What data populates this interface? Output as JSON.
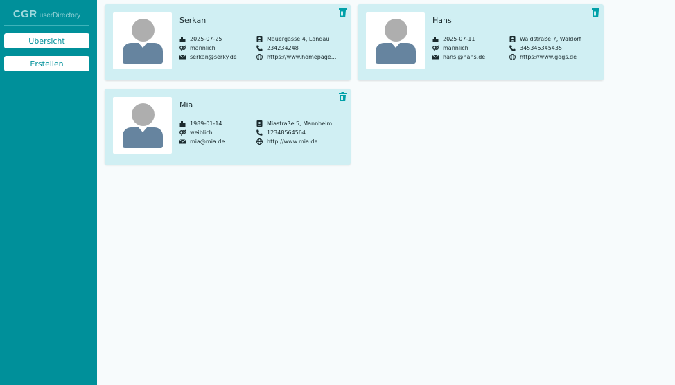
{
  "sidebar": {
    "logo_main": "CGR",
    "logo_sub": "userDirectory",
    "nav": [
      "Übersicht",
      "Erstellen"
    ]
  },
  "colors": {
    "sidebar": "#00909a",
    "card": "#d0eff3",
    "accent": "#00a0a8",
    "avatar_head": "#aeaeae",
    "avatar_body": "#66849f"
  },
  "users": [
    {
      "name": "Serkan",
      "birthday": "2025-07-25",
      "gender": "männlich",
      "email": "serkan@serky.de",
      "address": "Mauergasse 4, Landau",
      "phone": "234234248",
      "website": "https://www.homepage..."
    },
    {
      "name": "Hans",
      "birthday": "2025-07-11",
      "gender": "männlich",
      "email": "hansi@hans.de",
      "address": "Waldstraße 7, Waldorf",
      "phone": "345345345435",
      "website": "https://www.gdgs.de"
    },
    {
      "name": "Mia",
      "birthday": "1989-01-14",
      "gender": "weiblich",
      "email": "mia@mia.de",
      "address": "Miastraße 5, Mannheim",
      "phone": "12348564564",
      "website": "http://www.mia.de"
    }
  ]
}
